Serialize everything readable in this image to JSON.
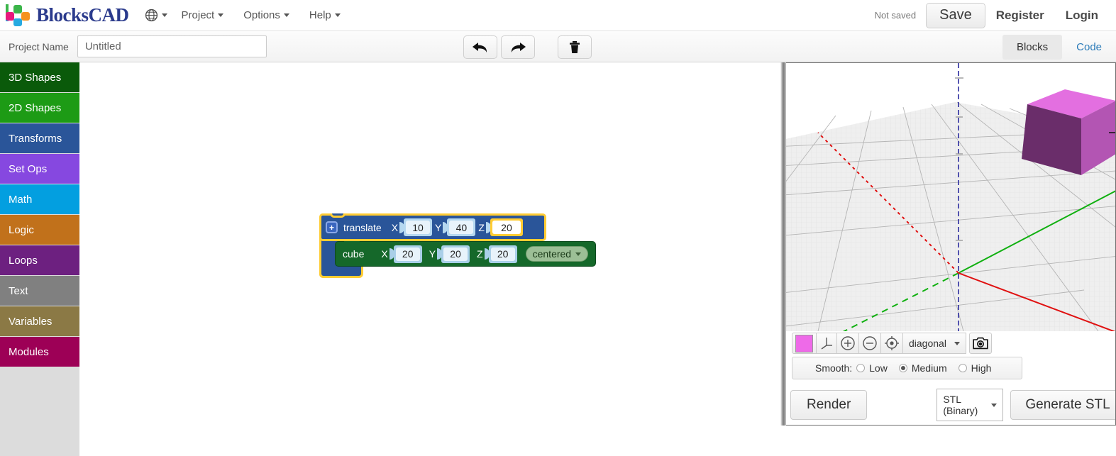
{
  "app": {
    "brand": "BlocksCAD"
  },
  "nav": {
    "globe_icon": "globe-icon",
    "items": [
      {
        "label": "Project",
        "icon": "chevron-down-icon"
      },
      {
        "label": "Options",
        "icon": "chevron-down-icon"
      },
      {
        "label": "Help",
        "icon": "chevron-down-icon"
      }
    ],
    "save_status": "Not saved",
    "save_label": "Save",
    "register_label": "Register",
    "login_label": "Login"
  },
  "projectbar": {
    "label": "Project Name",
    "value": "Untitled",
    "placeholder": "Untitled",
    "tools": [
      {
        "name": "undo-button",
        "icon": "undo-arrow-icon"
      },
      {
        "name": "redo-button",
        "icon": "redo-arrow-icon"
      },
      {
        "name": "delete-button",
        "icon": "trash-icon"
      }
    ],
    "tabs": [
      {
        "label": "Blocks",
        "active": true
      },
      {
        "label": "Code",
        "active": false
      }
    ]
  },
  "sidebar": {
    "items": [
      {
        "label": "3D Shapes",
        "color": "#0a5a0a"
      },
      {
        "label": "2D Shapes",
        "color": "#1d9b15"
      },
      {
        "label": "Transforms",
        "color": "#2a5599"
      },
      {
        "label": "Set Ops",
        "color": "#8648e0"
      },
      {
        "label": "Math",
        "color": "#039fe0"
      },
      {
        "label": "Logic",
        "color": "#c1711b"
      },
      {
        "label": "Loops",
        "color": "#6d2080"
      },
      {
        "label": "Text",
        "color": "#808080"
      },
      {
        "label": "Variables",
        "color": "#8b7945"
      },
      {
        "label": "Modules",
        "color": "#9d0056"
      }
    ]
  },
  "workspace": {
    "blocks": [
      {
        "type": "translate",
        "label": "translate",
        "selected": true,
        "mutator_icon": "plus-icon",
        "color": "#2a5599",
        "fields": [
          {
            "axis": "X",
            "value": "10",
            "editing": false
          },
          {
            "axis": "Y",
            "value": "40",
            "editing": false
          },
          {
            "axis": "Z",
            "value": "20",
            "editing": true
          }
        ]
      },
      {
        "type": "cube",
        "label": "cube",
        "selected": false,
        "color": "#15682a",
        "fields": [
          {
            "axis": "X",
            "value": "20",
            "editing": false
          },
          {
            "axis": "Y",
            "value": "20",
            "editing": false
          },
          {
            "axis": "Z",
            "value": "20",
            "editing": false
          }
        ],
        "dropdown": {
          "value": "centered",
          "icon": "chevron-down-icon"
        }
      }
    ]
  },
  "viewport": {
    "object_color": "#ee6ae8",
    "axes": {
      "x_color": "#e01010",
      "y_color": "#10b010",
      "z_color": "#2020a0"
    },
    "toolbar": {
      "color_swatch": "#ee6ae8",
      "buttons": [
        {
          "name": "color-swatch-button",
          "icon": "color-square-icon"
        },
        {
          "name": "axes-toggle-button",
          "icon": "axes-icon"
        },
        {
          "name": "zoom-in-button",
          "icon": "plus-circle-icon"
        },
        {
          "name": "zoom-out-button",
          "icon": "minus-circle-icon"
        },
        {
          "name": "recenter-button",
          "icon": "target-icon"
        }
      ],
      "view_select": "diagonal",
      "view_caret": "chevron-down-icon",
      "screenshot_icon": "camera-icon"
    },
    "smooth": {
      "label": "Smooth:",
      "options": [
        {
          "label": "Low",
          "selected": false
        },
        {
          "label": "Medium",
          "selected": true
        },
        {
          "label": "High",
          "selected": false
        }
      ]
    },
    "actions": {
      "render_label": "Render",
      "format_value": "STL (Binary)",
      "format_caret": "chevron-down-icon",
      "generate_label": "Generate STL"
    }
  }
}
